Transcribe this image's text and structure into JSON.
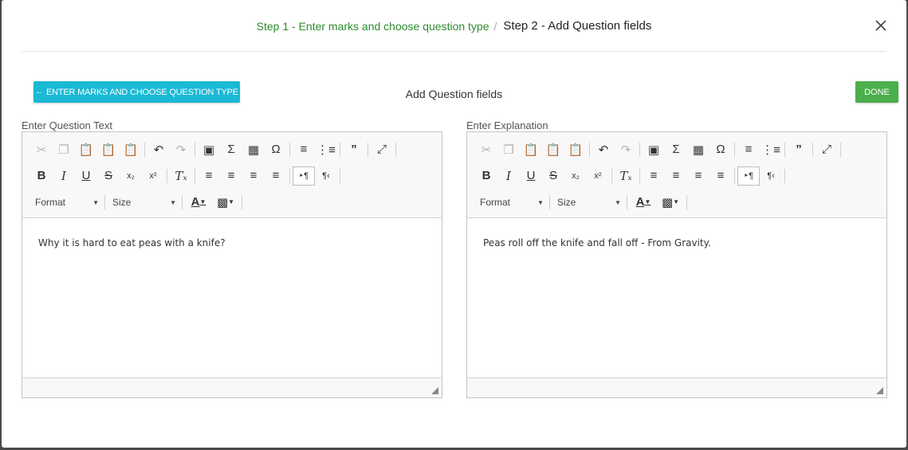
{
  "steps": {
    "step1": "Step 1  -  Enter marks and choose question type",
    "separator": "/",
    "step2": "Step 2  -  Add Question fields"
  },
  "header": {
    "back_label": "ENTER MARKS AND CHOOSE QUESTION TYPE",
    "title": "Add Question fields",
    "done_label": "DONE"
  },
  "editors": {
    "question": {
      "label": "Enter Question Text",
      "content": "Why it is hard to eat peas with a knife?"
    },
    "explanation": {
      "label": "Enter Explanation",
      "content": "Peas roll off the knife and fall off - From Gravity."
    }
  },
  "toolbar": {
    "format_label": "Format",
    "size_label": "Size"
  },
  "colors": {
    "step1": "#2e8b2e",
    "back_button": "#1ab9d4",
    "done_button": "#4cae4c"
  },
  "icons": {
    "close": "close-icon",
    "back_arrow": "arrow-left-icon"
  }
}
